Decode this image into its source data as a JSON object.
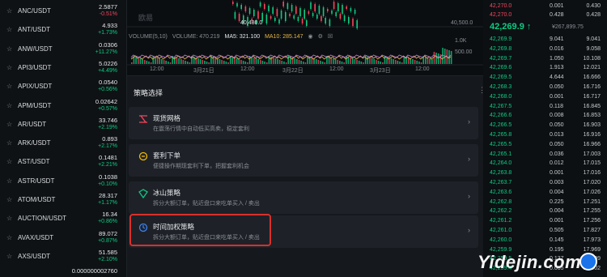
{
  "watchlist": [
    {
      "star": "☆",
      "symbol": "ANC/USDT",
      "price": "2.5877",
      "change": "-0.51%",
      "dir": "dn"
    },
    {
      "star": "☆",
      "symbol": "ANT/USDT",
      "price": "4.933",
      "change": "+1.73%",
      "dir": "up"
    },
    {
      "star": "☆",
      "symbol": "ANW/USDT",
      "price": "0.0306",
      "change": "+11.27%",
      "dir": "up"
    },
    {
      "star": "☆",
      "symbol": "API3/USDT",
      "price": "5.0226",
      "change": "+4.49%",
      "dir": "up"
    },
    {
      "star": "☆",
      "symbol": "APIX/USDT",
      "price": "0.0540",
      "change": "+0.56%",
      "dir": "up"
    },
    {
      "star": "☆",
      "symbol": "APM/USDT",
      "price": "0.02642",
      "change": "+0.57%",
      "dir": "up"
    },
    {
      "star": "☆",
      "symbol": "AR/USDT",
      "price": "33.746",
      "change": "+2.19%",
      "dir": "up"
    },
    {
      "star": "☆",
      "symbol": "ARK/USDT",
      "price": "0.893",
      "change": "+2.17%",
      "dir": "up"
    },
    {
      "star": "☆",
      "symbol": "AST/USDT",
      "price": "0.1481",
      "change": "+2.21%",
      "dir": "up"
    },
    {
      "star": "☆",
      "symbol": "ASTR/USDT",
      "price": "0.1038",
      "change": "+0.10%",
      "dir": "up"
    },
    {
      "star": "☆",
      "symbol": "ATOM/USDT",
      "price": "28.317",
      "change": "+1.17%",
      "dir": "up"
    },
    {
      "star": "☆",
      "symbol": "AUCTION/USDT",
      "price": "16.34",
      "change": "+0.86%",
      "dir": "up"
    },
    {
      "star": "☆",
      "symbol": "AVAX/USDT",
      "price": "89.072",
      "change": "+0.87%",
      "dir": "up"
    },
    {
      "star": "☆",
      "symbol": "AXS/USDT",
      "price": "51.585",
      "change": "+2.10%",
      "dir": "up"
    },
    {
      "star": "",
      "symbol": "",
      "price": "0.000000002760",
      "change": "",
      "dir": "up"
    }
  ],
  "chart": {
    "price_label": "40,480.0",
    "right_axis_label": "40,500.0",
    "vol_labels": {
      "vol_setting": "VOLUME(5,10)",
      "volume": "VOLUME: 470.219",
      "ma5": "MA5: 321.100",
      "ma10": "MA10: 285.147"
    },
    "vol_axis": [
      "1.0K",
      "500.00"
    ],
    "x_axis": [
      "12:00",
      "3月21日",
      "12:00",
      "3月22日",
      "12:00",
      "3月23日",
      "12:00"
    ],
    "watermark": "欧易"
  },
  "strategy": {
    "title": "策略选择",
    "more": "⋮",
    "cards": [
      {
        "title": "现货网格",
        "desc": "在震荡行情中自动低买高卖，稳定套利",
        "arrow": "›"
      },
      {
        "title": "套利下单",
        "desc": "便捷操作期现套利下单，把握套利机会",
        "arrow": "›"
      },
      {
        "title": "冰山策略",
        "desc": "拆分大额订单，贴近盘口来吃单买入 / 卖出",
        "arrow": "›"
      },
      {
        "title": "时间加权策略",
        "desc": "拆分大额订单，贴近盘口来吃单买入 / 卖出",
        "arrow": "›"
      }
    ]
  },
  "orderbook": {
    "asks": [
      {
        "price": "42,270.0",
        "amount": "0.001",
        "total": "0.430"
      },
      {
        "price": "42,270.0",
        "amount": "0.428",
        "total": "0.428"
      }
    ],
    "last_price": "42,269.9 ↑",
    "last_usd": "¥267,899.75",
    "bids": [
      {
        "price": "42,269.9",
        "amount": "9.041",
        "total": "9.041"
      },
      {
        "price": "42,269.8",
        "amount": "0.016",
        "total": "9.058"
      },
      {
        "price": "42,269.7",
        "amount": "1.050",
        "total": "10.108"
      },
      {
        "price": "42,269.6",
        "amount": "1.913",
        "total": "12.021"
      },
      {
        "price": "42,269.5",
        "amount": "4.644",
        "total": "16.666"
      },
      {
        "price": "42,268.3",
        "amount": "0.050",
        "total": "16.716"
      },
      {
        "price": "42,268.0",
        "amount": "0.001",
        "total": "16.717"
      },
      {
        "price": "42,267.5",
        "amount": "0.118",
        "total": "16.845"
      },
      {
        "price": "42,266.6",
        "amount": "0.008",
        "total": "16.853"
      },
      {
        "price": "42,266.5",
        "amount": "0.050",
        "total": "16.903"
      },
      {
        "price": "42,265.8",
        "amount": "0.013",
        "total": "16.916"
      },
      {
        "price": "42,265.5",
        "amount": "0.050",
        "total": "16.966"
      },
      {
        "price": "42,265.1",
        "amount": "0.036",
        "total": "17.003"
      },
      {
        "price": "42,264.0",
        "amount": "0.012",
        "total": "17.015"
      },
      {
        "price": "42,263.8",
        "amount": "0.001",
        "total": "17.016"
      },
      {
        "price": "42,263.7",
        "amount": "0.003",
        "total": "17.020"
      },
      {
        "price": "42,263.6",
        "amount": "0.004",
        "total": "17.026"
      },
      {
        "price": "42,262.8",
        "amount": "0.225",
        "total": "17.251"
      },
      {
        "price": "42,262.2",
        "amount": "0.004",
        "total": "17.255"
      },
      {
        "price": "42,261.2",
        "amount": "0.001",
        "total": "17.256"
      },
      {
        "price": "42,261.0",
        "amount": "0.505",
        "total": "17.827"
      },
      {
        "price": "42,260.0",
        "amount": "0.145",
        "total": "17.973"
      },
      {
        "price": "42,259.9",
        "amount": "0.195",
        "total": "17.969"
      },
      {
        "price": "42,259.5",
        "amount": "0.137",
        "total": "17.999"
      },
      {
        "price": "42,259.4",
        "amount": "0.005",
        "total": "18.002"
      }
    ]
  },
  "watermark": "Yidejin.com",
  "colors": {
    "up": "#0ecb81",
    "down": "#f6465d",
    "highlight": "#d9302c"
  }
}
